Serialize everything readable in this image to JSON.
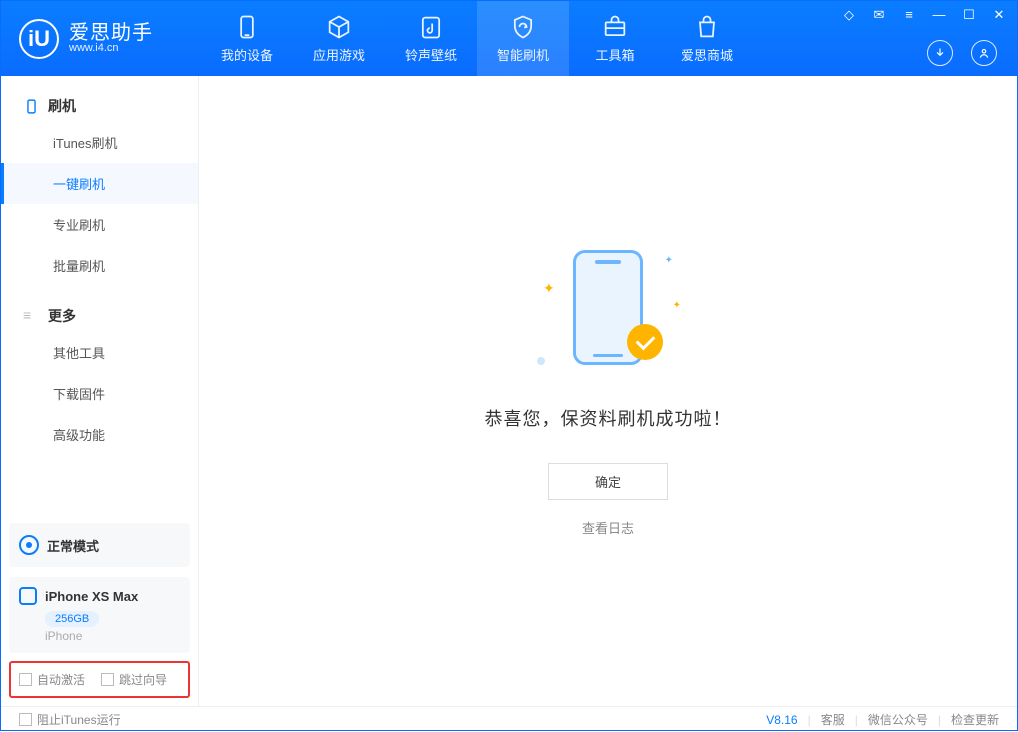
{
  "logo": {
    "title": "爱思助手",
    "subtitle": "www.i4.cn",
    "glyph": "iU"
  },
  "nav": [
    {
      "label": "我的设备"
    },
    {
      "label": "应用游戏"
    },
    {
      "label": "铃声壁纸"
    },
    {
      "label": "智能刷机"
    },
    {
      "label": "工具箱"
    },
    {
      "label": "爱思商城"
    }
  ],
  "sidebar": {
    "section1": "刷机",
    "items1": [
      "iTunes刷机",
      "一键刷机",
      "专业刷机",
      "批量刷机"
    ],
    "section2": "更多",
    "items2": [
      "其他工具",
      "下载固件",
      "高级功能"
    ],
    "mode": "正常模式",
    "device": {
      "name": "iPhone XS Max",
      "capacity": "256GB",
      "type": "iPhone"
    },
    "check1": "自动激活",
    "check2": "跳过向导"
  },
  "main": {
    "success": "恭喜您，保资料刷机成功啦！",
    "ok": "确定",
    "log": "查看日志"
  },
  "footer": {
    "block_itunes": "阻止iTunes运行",
    "version": "V8.16",
    "service": "客服",
    "wechat": "微信公众号",
    "update": "检查更新"
  }
}
